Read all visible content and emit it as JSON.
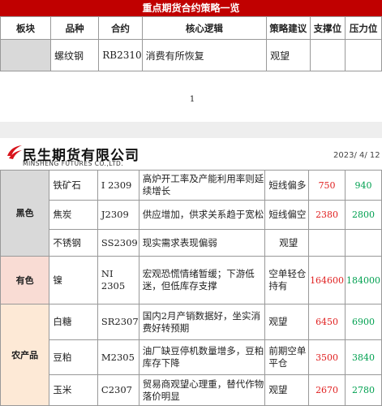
{
  "top_table": {
    "banner": "重点期货合约策略一览",
    "headers": [
      "板块",
      "品种",
      "合约",
      "核心逻辑",
      "策略建议",
      "支撑位",
      "压力位"
    ],
    "row": {
      "sector": "",
      "variety": "螺纹钢",
      "contract": "RB2310",
      "logic": "消费有所恢复",
      "strategy": "观望",
      "support": "",
      "resistance": ""
    },
    "page_number": "1"
  },
  "header": {
    "logo_cn": "民生期货有限公司",
    "logo_en": "MINSHENG FUTURES CO.,LTD.",
    "date": "2023/ 4/ 12"
  },
  "colors": {
    "banner": "#c00000",
    "black_sector": "#d9d9d9",
    "nonferrous_sector": "#f9dcd4",
    "agri_sector": "#fde9d6",
    "support": "#e02020",
    "resistance": "#00a050"
  },
  "sectors": [
    {
      "name": "黑色",
      "rows": [
        {
          "variety": "铁矿石",
          "contract": "I 2309",
          "logic": "高炉开工率及产能利用率则延续增长",
          "strategy": "短线偏多",
          "support": "750",
          "resistance": "940"
        },
        {
          "variety": "焦炭",
          "contract": "J2309",
          "logic": "供应增加，供求关系趋于宽松",
          "strategy": "短线偏空",
          "support": "2380",
          "resistance": "2800"
        },
        {
          "variety": "不锈钢",
          "contract": "SS2309",
          "logic": "现实需求表现偏弱",
          "strategy": "观望",
          "support": "",
          "resistance": ""
        }
      ]
    },
    {
      "name": "有色",
      "rows": [
        {
          "variety": "镍",
          "contract": "NI 2305",
          "logic": "宏观恐慌情绪暂缓；下游低迷，但低库存支撑",
          "strategy": "空单轻仓持有",
          "support": "164600",
          "resistance": "184000"
        }
      ]
    },
    {
      "name": "农产品",
      "rows": [
        {
          "variety": "白糖",
          "contract": "SR2307",
          "logic": "国内2月产销数据好，坐实消费好转预期",
          "strategy": "观望",
          "support": "6450",
          "resistance": "6900"
        },
        {
          "variety": "豆粕",
          "contract": "M2305",
          "logic": "油厂缺豆停机数量增多，豆粕库存下降",
          "strategy": "前期空单平仓",
          "support": "3500",
          "resistance": "3840"
        },
        {
          "variety": "玉米",
          "contract": "C2307",
          "logic": "贸易商观望心理重，替代作物落价明显",
          "strategy": "观望",
          "support": "2670",
          "resistance": "2780"
        }
      ]
    }
  ]
}
